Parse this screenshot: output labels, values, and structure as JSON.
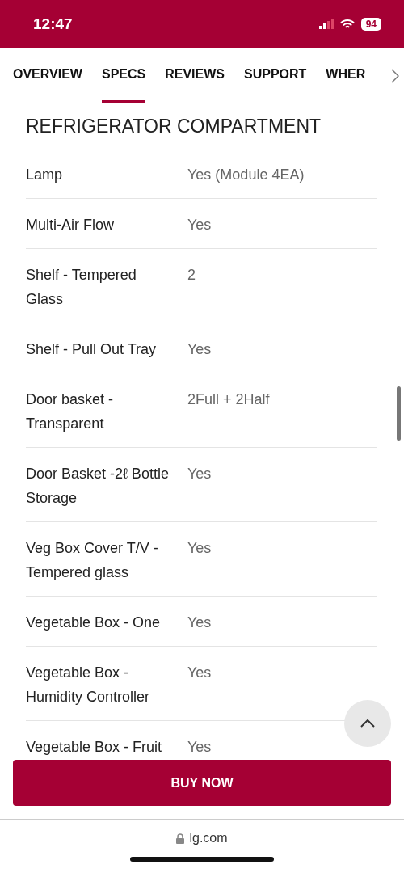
{
  "status_bar": {
    "time": "12:47",
    "battery": "94"
  },
  "tabs": [
    {
      "label": "OVERVIEW",
      "selected": false
    },
    {
      "label": "SPECS",
      "selected": true
    },
    {
      "label": "REVIEWS",
      "selected": false
    },
    {
      "label": "SUPPORT",
      "selected": false
    },
    {
      "label": "WHER",
      "selected": false
    }
  ],
  "section": {
    "title": "REFRIGERATOR COMPARTMENT",
    "rows": [
      {
        "label": "Lamp",
        "value": "Yes (Module 4EA)"
      },
      {
        "label": "Multi-Air Flow",
        "value": "Yes"
      },
      {
        "label": "Shelf - Tempered Glass",
        "value": "2"
      },
      {
        "label": "Shelf - Pull Out Tray",
        "value": "Yes"
      },
      {
        "label": "Door basket - Transparent",
        "value": "2Full + 2Half"
      },
      {
        "label": "Door Basket -2ℓ Bottle Storage",
        "value": "Yes"
      },
      {
        "label": "Veg Box Cover T/V - Tempered glass",
        "value": "Yes"
      },
      {
        "label": "Vegetable Box - One",
        "value": "Yes"
      },
      {
        "label": "Vegetable Box - Humidity Controller",
        "value": "Yes"
      },
      {
        "label": "Vegetable Box - Fruit",
        "value": "Yes"
      }
    ]
  },
  "buy_button": "BUY NOW",
  "address_bar": {
    "url": "lg.com"
  }
}
